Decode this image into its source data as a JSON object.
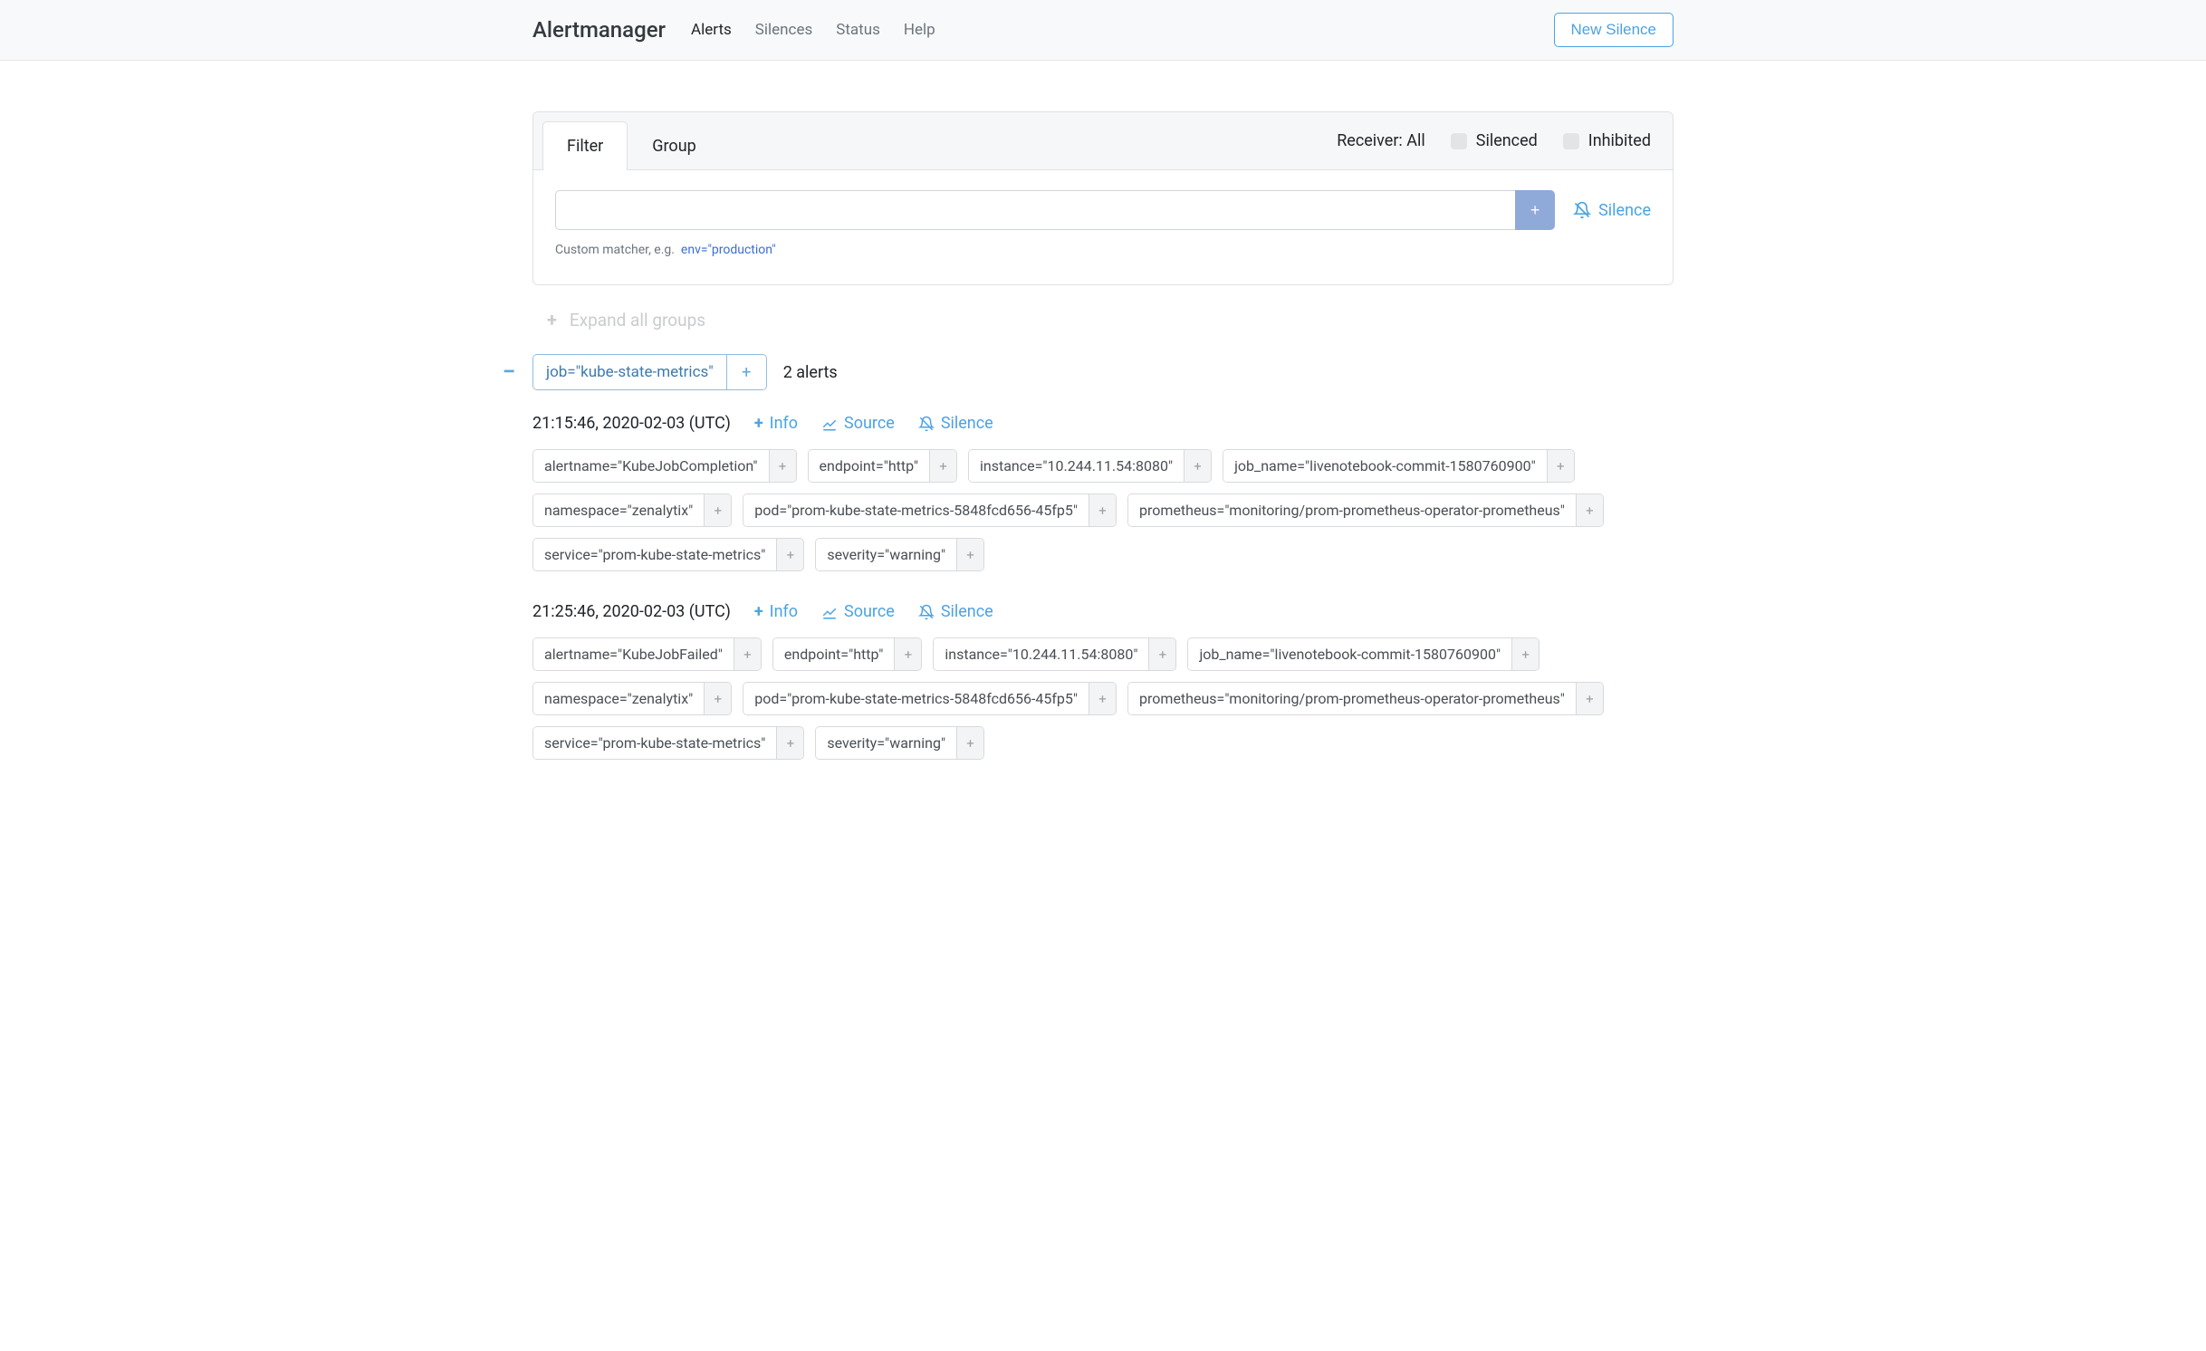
{
  "nav": {
    "brand": "Alertmanager",
    "links": [
      "Alerts",
      "Silences",
      "Status",
      "Help"
    ],
    "active": 0,
    "new_silence": "New Silence"
  },
  "panel": {
    "tabs": [
      "Filter",
      "Group"
    ],
    "active_tab": 0,
    "receiver_label": "Receiver: All",
    "silenced_label": "Silenced",
    "inhibited_label": "Inhibited",
    "filter_value": "",
    "silence_btn": "Silence",
    "hint_prefix": "Custom matcher, e.g.",
    "hint_example": "env=\"production\""
  },
  "expand_all": "Expand all groups",
  "group": {
    "label": "job=\"kube-state-metrics\"",
    "count": "2 alerts"
  },
  "alerts": [
    {
      "time": "21:15:46, 2020-02-03 (UTC)",
      "info": "Info",
      "source": "Source",
      "silence": "Silence",
      "labels": [
        "alertname=\"KubeJobCompletion\"",
        "endpoint=\"http\"",
        "instance=\"10.244.11.54:8080\"",
        "job_name=\"livenotebook-commit-1580760900\"",
        "namespace=\"zenalytix\"",
        "pod=\"prom-kube-state-metrics-5848fcd656-45fp5\"",
        "prometheus=\"monitoring/prom-prometheus-operator-prometheus\"",
        "service=\"prom-kube-state-metrics\"",
        "severity=\"warning\""
      ]
    },
    {
      "time": "21:25:46, 2020-02-03 (UTC)",
      "info": "Info",
      "source": "Source",
      "silence": "Silence",
      "labels": [
        "alertname=\"KubeJobFailed\"",
        "endpoint=\"http\"",
        "instance=\"10.244.11.54:8080\"",
        "job_name=\"livenotebook-commit-1580760900\"",
        "namespace=\"zenalytix\"",
        "pod=\"prom-kube-state-metrics-5848fcd656-45fp5\"",
        "prometheus=\"monitoring/prom-prometheus-operator-prometheus\"",
        "service=\"prom-kube-state-metrics\"",
        "severity=\"warning\""
      ]
    }
  ]
}
